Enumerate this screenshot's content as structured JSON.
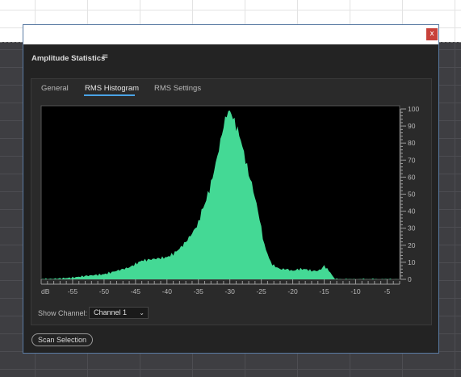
{
  "window": {
    "close_glyph": "x"
  },
  "panel": {
    "title": "Amplitude Statistics",
    "menu_glyph": "≡"
  },
  "tabs": [
    {
      "label": "General",
      "active": false
    },
    {
      "label": "RMS Histogram",
      "active": true
    },
    {
      "label": "RMS Settings",
      "active": false
    }
  ],
  "controls": {
    "show_channel_label": "Show Channel:",
    "channel_value": "Channel 1",
    "chevron_icon": "chevron-down-icon",
    "scan_button": "Scan Selection"
  },
  "colors": {
    "histogram_fill": "#44d995",
    "plot_background": "#000000",
    "accent": "#4aa3e6",
    "close_button": "#c8413a"
  },
  "chart_data": {
    "type": "area",
    "title": "",
    "xlabel": "dB",
    "ylabel": "",
    "xlim": [
      -60,
      -3
    ],
    "ylim": [
      0,
      100
    ],
    "x_ticks": [
      -55,
      -50,
      -45,
      -40,
      -35,
      -30,
      -25,
      -20,
      -15,
      -10,
      -5
    ],
    "y_ticks": [
      0,
      10,
      20,
      30,
      40,
      50,
      60,
      70,
      80,
      90,
      100
    ],
    "x": [
      -60,
      -57,
      -55,
      -53,
      -50,
      -48,
      -46,
      -45,
      -44,
      -42,
      -40,
      -39,
      -38,
      -37,
      -36,
      -35,
      -34.5,
      -34,
      -33.5,
      -33,
      -32.5,
      -32,
      -31.5,
      -31,
      -30.5,
      -30,
      -29.5,
      -29,
      -28.5,
      -28,
      -27.5,
      -27,
      -26.5,
      -26,
      -25.5,
      -25,
      -24.5,
      -24,
      -23.5,
      -23,
      -22.5,
      -22,
      -21,
      -20,
      -19,
      -18,
      -17,
      -16,
      -15.5,
      -15,
      -14.5,
      -14,
      -13.5,
      -13,
      -10,
      -3
    ],
    "y": [
      0,
      0.5,
      1,
      2,
      3,
      5,
      7,
      9,
      11,
      12,
      13,
      15,
      18,
      22,
      27,
      33,
      40,
      44,
      50,
      56,
      64,
      72,
      81,
      90,
      97,
      99,
      95,
      90,
      85,
      78,
      70,
      62,
      56,
      48,
      40,
      30,
      20,
      15,
      10,
      8,
      7,
      6,
      6,
      5,
      6,
      6,
      5,
      5,
      6,
      8,
      6,
      4,
      1,
      0,
      0,
      0
    ]
  }
}
